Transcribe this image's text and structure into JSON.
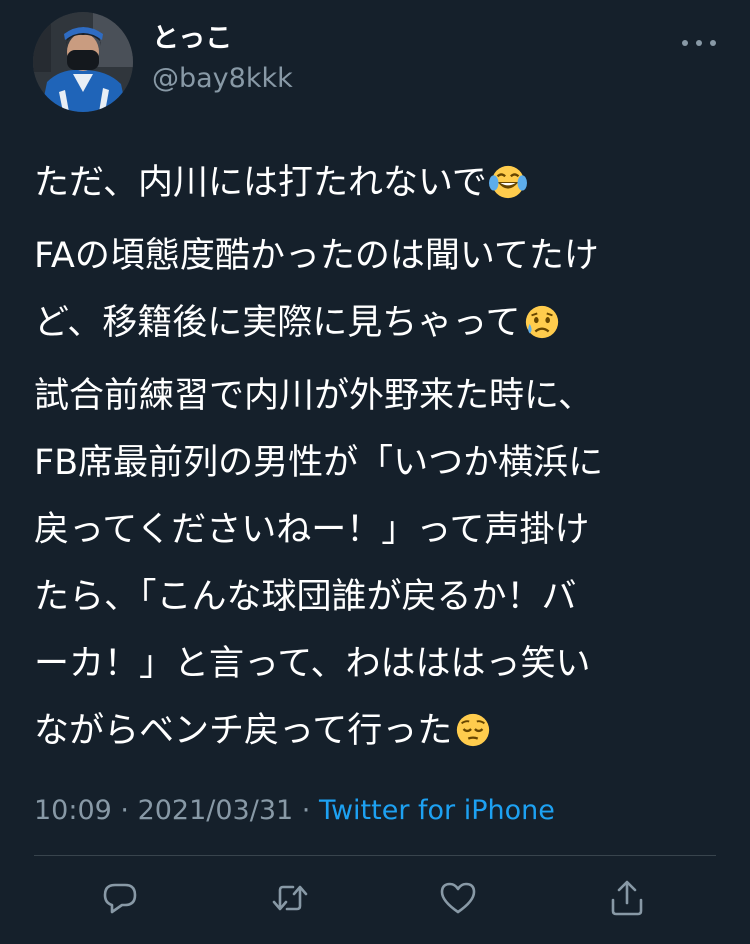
{
  "author": {
    "display_name": "とっこ",
    "handle": "@bay8kkk"
  },
  "tweet": {
    "paragraphs": [
      {
        "lines": [
          "ただ、内川には打たれないで"
        ],
        "emoji": "face-with-tears-of-joy-emoji"
      },
      {
        "lines": [
          "FAの頃態度酷かったのは聞いてたけ",
          "ど、移籍後に実際に見ちゃって"
        ],
        "emoji": "sad-but-relieved-face-emoji"
      },
      {
        "lines": [
          "試合前練習で内川が外野来た時に、",
          "FB席最前列の男性が「いつか横浜に",
          "戻ってくださいねー！」って声掛け",
          "たら、「こんな球団誰が戻るか！バ",
          "ーカ！」と言って、わはははっ笑い",
          "ながらベンチ戻って行った"
        ],
        "emoji": "pensive-face-emoji"
      }
    ]
  },
  "meta": {
    "time": "10:09",
    "separator": " · ",
    "date": "2021/03/31",
    "source": "Twitter for iPhone"
  },
  "icons": {
    "more": "more-dots-icon",
    "reply": "reply-icon",
    "retweet": "retweet-icon",
    "like": "heart-icon",
    "share": "share-icon"
  },
  "colors": {
    "background": "#15202b",
    "text": "#ffffff",
    "secondary": "#8899a6",
    "link": "#1da1f2",
    "divider": "#38444d"
  }
}
